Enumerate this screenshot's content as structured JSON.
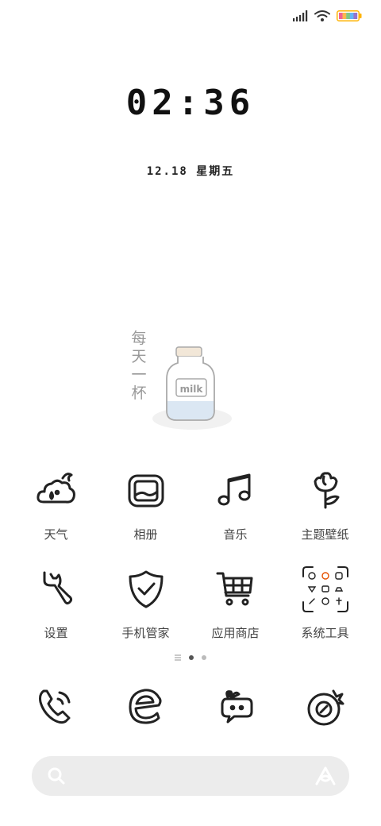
{
  "status_bar": {
    "signal_icon": "signal-icon",
    "wifi_icon": "wifi-icon",
    "battery_icon": "battery-icon",
    "battery_colors": [
      "#f06292",
      "#ffb74d",
      "#81c784",
      "#64b5f6",
      "#9575cd"
    ]
  },
  "clock": {
    "time": "02:36",
    "date": "12.18 星期五"
  },
  "widget": {
    "chars": [
      "每",
      "天",
      "一",
      "杯"
    ],
    "jar_label": "milk"
  },
  "apps_row1": [
    {
      "label": "天气",
      "icon": "weather-icon"
    },
    {
      "label": "相册",
      "icon": "gallery-icon"
    },
    {
      "label": "音乐",
      "icon": "music-icon"
    },
    {
      "label": "主题壁纸",
      "icon": "theme-icon"
    }
  ],
  "apps_row2": [
    {
      "label": "设置",
      "icon": "settings-icon"
    },
    {
      "label": "手机管家",
      "icon": "security-icon"
    },
    {
      "label": "应用商店",
      "icon": "app-store-icon"
    },
    {
      "label": "系统工具",
      "icon": "system-tools-folder-icon"
    }
  ],
  "page_indicator": {
    "pages": 3,
    "current": 2
  },
  "dock": [
    {
      "icon": "phone-icon"
    },
    {
      "icon": "browser-icon"
    },
    {
      "icon": "messages-icon"
    },
    {
      "icon": "camera-icon"
    }
  ],
  "search_bar": {
    "search_icon": "search-icon",
    "assistant_icon": "assistant-icon"
  }
}
